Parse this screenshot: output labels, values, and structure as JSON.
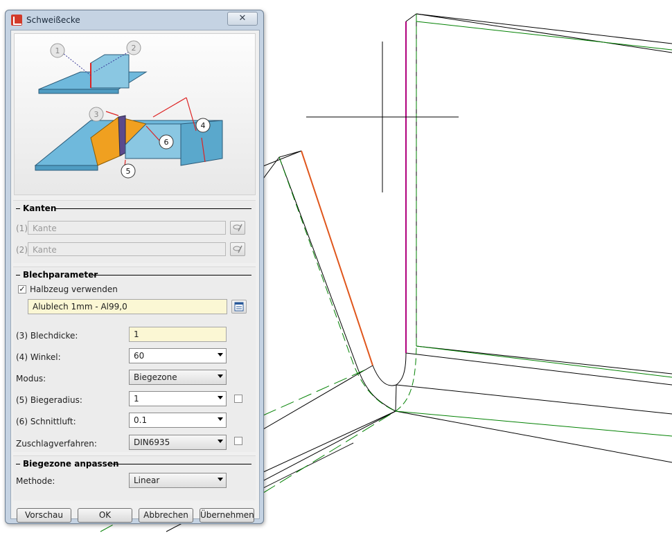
{
  "dialog": {
    "title": "Schweißecke",
    "close_glyph": "✕"
  },
  "illustration": {
    "callouts": [
      "1",
      "2",
      "3",
      "4",
      "5",
      "6"
    ]
  },
  "kanten": {
    "header": "Kanten",
    "rows": [
      {
        "label": "(1)",
        "placeholder": "Kante"
      },
      {
        "label": "(2)",
        "placeholder": "Kante"
      }
    ]
  },
  "blech": {
    "header": "Blechparameter",
    "halbzeug_label": "Halbzeug verwenden",
    "halbzeug_checked": "✓",
    "halbzeug_value": "Alublech 1mm - Al99,0",
    "blechdicke_label": "(3) Blechdicke:",
    "blechdicke_value": "1",
    "winkel_label": "(4) Winkel:",
    "winkel_value": "60",
    "modus_label": "Modus:",
    "modus_value": "Biegezone",
    "biegeradius_label": "(5) Biegeradius:",
    "biegeradius_value": "1",
    "schnittluft_label": "(6) Schnittluft:",
    "schnittluft_value": "0.1",
    "zuschlag_label": "Zuschlagverfahren:",
    "zuschlag_value": "DIN6935"
  },
  "biegezone": {
    "header": "Biegezone anpassen",
    "methode_label": "Methode:",
    "methode_value": "Linear"
  },
  "buttons": {
    "preview": "Vorschau",
    "ok": "OK",
    "cancel": "Abbrechen",
    "apply": "Übernehmen"
  },
  "colors": {
    "selected_edge_orange": "#e0561c",
    "selected_edge_magenta": "#b0007c",
    "sheet_outline_green": "#008000",
    "sheet_fill_blue": "#6fb9dc",
    "weld_fill_orange": "#f0a020"
  }
}
